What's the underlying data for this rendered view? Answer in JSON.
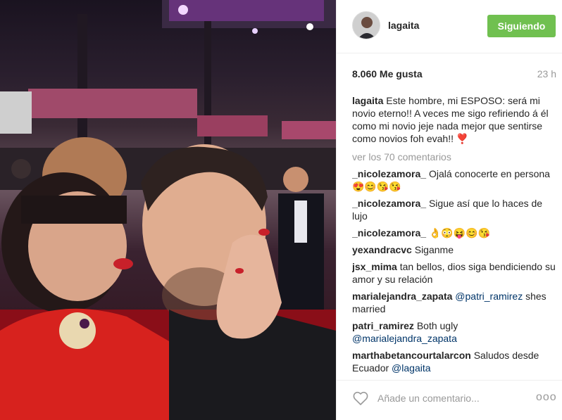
{
  "post": {
    "username": "lagaita",
    "follow_label": "Siguiendo",
    "likes": "8.060 Me gusta",
    "time_ago": "23 h",
    "caption_user": "lagaita",
    "caption_text": "Este hombre, mi ESPOSO: será mi novio eterno!! A veces me sigo refiriendo á él como mi novio jeje nada mejor que sentirse como novios foh evah!! ❣️",
    "view_all": "ver los 70 comentarios"
  },
  "comments": [
    {
      "user": "_nicolezamora_",
      "text": "Ojalá conocerte en persona😍😊😘😘"
    },
    {
      "user": "_nicolezamora_",
      "text": "Sigue así que lo haces de lujo"
    },
    {
      "user": "_nicolezamora_",
      "text": "👌😳😝😊😘"
    },
    {
      "user": "yexandracvc",
      "text": "Siganme"
    },
    {
      "user": "jsx_mima",
      "text": "tan bellos, dios siga bendiciendo su amor y su relación"
    },
    {
      "user": "marialejandra_zapata",
      "mention": "@patri_ramirez",
      "text": "shes married"
    },
    {
      "user": "patri_ramirez",
      "text": "Both ugly",
      "mention": "@marialejandra_zapata"
    },
    {
      "user": "marthabetancourtalarcon",
      "text": "Saludos desde Ecuador",
      "mention": "@lagaita"
    }
  ],
  "footer": {
    "comment_placeholder": "Añade un comentario...",
    "heart_icon": "heart-outline-icon",
    "more_icon": "more-options-icon",
    "more_glyph": "ooo"
  },
  "colors": {
    "follow_button": "#70c050",
    "mention": "#003569",
    "muted": "#999999"
  }
}
